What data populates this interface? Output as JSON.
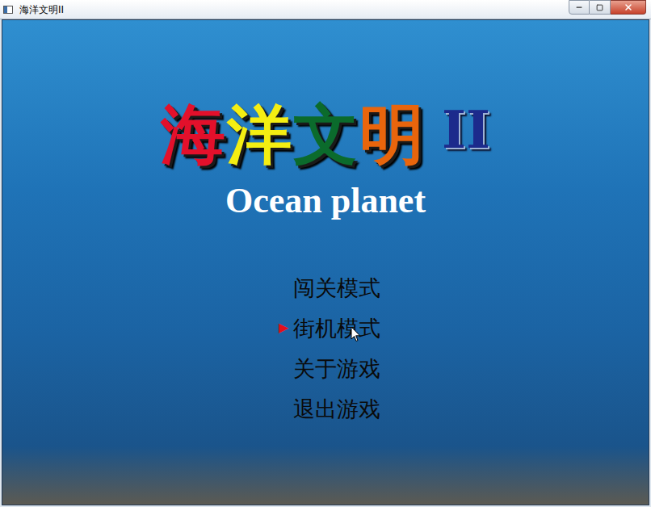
{
  "window": {
    "title": "海洋文明II"
  },
  "logo": {
    "characters": [
      {
        "text": "海",
        "color": "#e3102b"
      },
      {
        "text": "洋",
        "color": "#f4ee12"
      },
      {
        "text": "文",
        "color": "#0b6b2c"
      },
      {
        "text": "明",
        "color": "#e9650c"
      }
    ],
    "suffix": {
      "text": "II",
      "color": "#1c2a8c"
    }
  },
  "subtitle": "Ocean planet",
  "menu": {
    "marker": "▶",
    "items": [
      {
        "label": "闯关模式",
        "selected": false
      },
      {
        "label": "街机模式",
        "selected": true
      },
      {
        "label": "关于游戏",
        "selected": false
      },
      {
        "label": "退出游戏",
        "selected": false
      }
    ]
  }
}
